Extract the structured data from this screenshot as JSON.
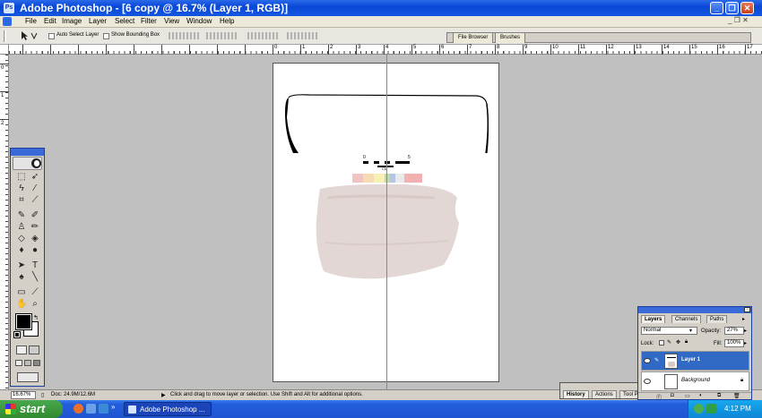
{
  "window": {
    "title": "Adobe Photoshop - [6 copy @ 16.7% (Layer 1, RGB)]",
    "minimize": "_",
    "restore": "❐",
    "close": "✕"
  },
  "menu": {
    "items": [
      "File",
      "Edit",
      "Image",
      "Layer",
      "Select",
      "Filter",
      "View",
      "Window",
      "Help"
    ],
    "doc_controls": "_ ❐ ✕"
  },
  "options": {
    "auto_select_label": "Auto Select Layer",
    "bounding_box_label": "Show Bounding Box",
    "well_tabs": [
      "File Browser",
      "Brushes"
    ]
  },
  "rulers": {
    "h_labels": [
      "0",
      "1",
      "2",
      "3",
      "4",
      "5",
      "6",
      "7",
      "8",
      "9",
      "10",
      "11",
      "12",
      "13",
      "14",
      "15",
      "16",
      "17"
    ],
    "v_labels": [
      "0",
      "1",
      "2"
    ]
  },
  "document": {
    "scale_numbers": [
      "0",
      "5"
    ],
    "scale_unit": "CM"
  },
  "status": {
    "zoom": "16.67%",
    "doc_info": "Doc: 24.9M/12.6M",
    "hint": "Click and drag to move layer or selection. Use Shift and Alt for additional options."
  },
  "history_palette": {
    "tabs": [
      "History",
      "Actions",
      "Tool Pr"
    ]
  },
  "layers_palette": {
    "tabs": [
      "Layers",
      "Channels",
      "Paths"
    ],
    "blend_mode": "Normal",
    "opacity_label": "Opacity:",
    "opacity_value": "27%",
    "lock_label": "Lock:",
    "fill_label": "Fill:",
    "fill_value": "100%",
    "layers": [
      {
        "name": "Layer 1",
        "selected": true
      },
      {
        "name": "Background",
        "selected": false
      }
    ]
  },
  "taskbar": {
    "start_label": "start",
    "task_label": "Adobe Photoshop ...",
    "clock": "4:12 PM"
  },
  "colors": {
    "title_bar": "#0a48d8",
    "guide": "#5b8fd8",
    "selected_layer": "#316ac5"
  }
}
